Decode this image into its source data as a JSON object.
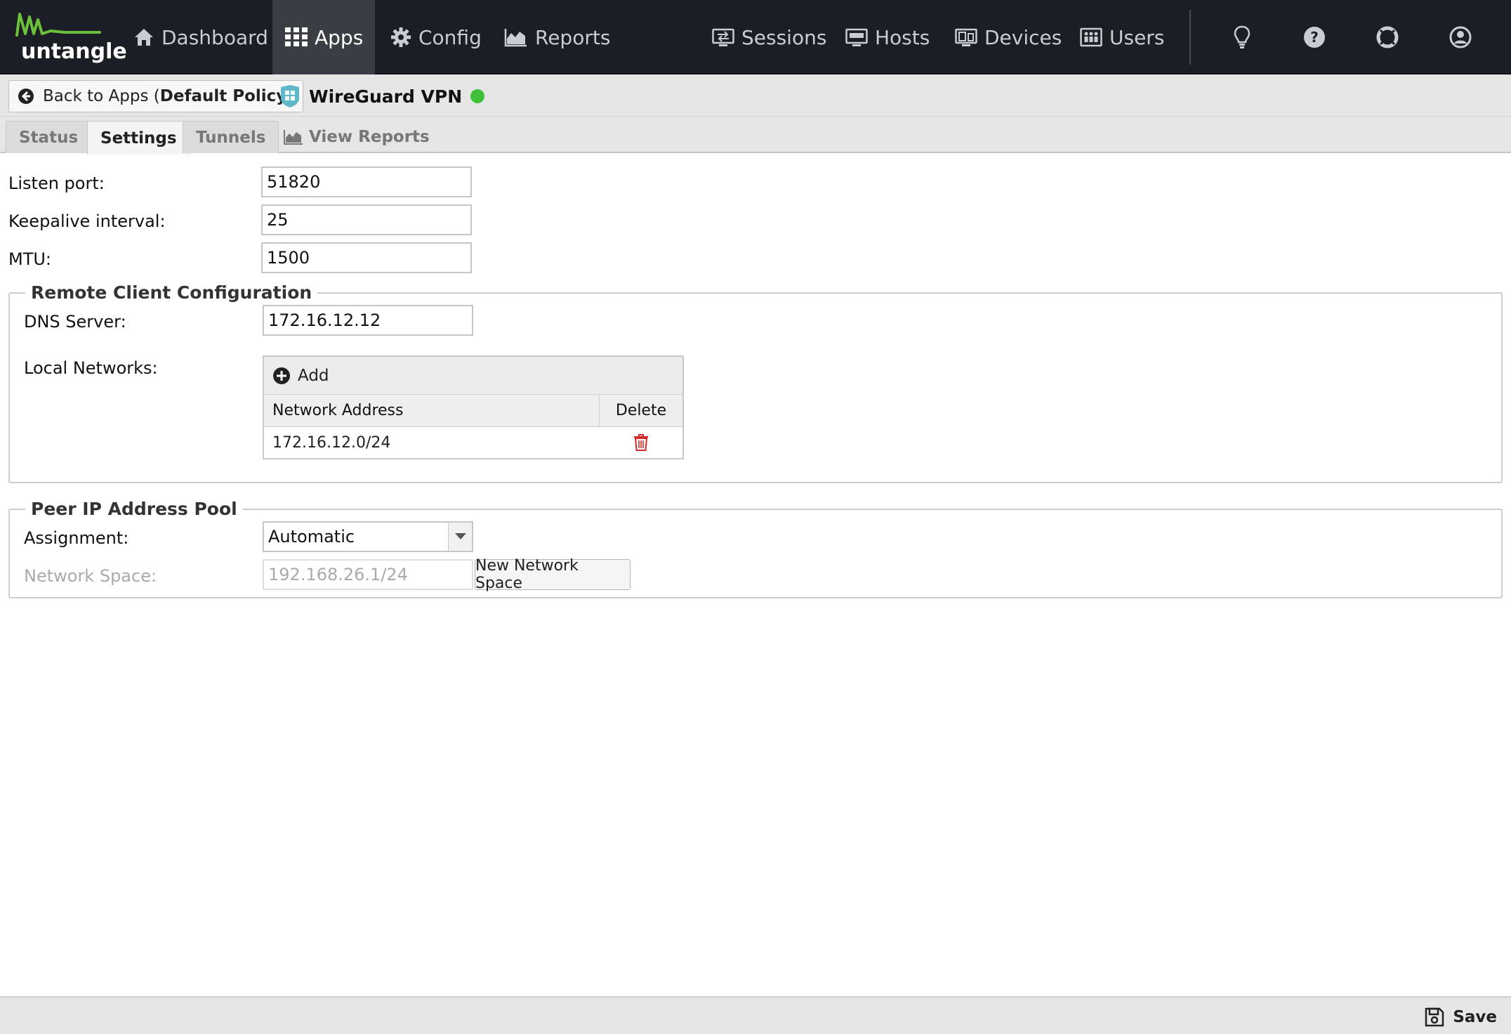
{
  "brand": {
    "logo_text": "untangle",
    "accent": "#6cbf3b"
  },
  "nav": {
    "dashboard": "Dashboard",
    "apps": "Apps",
    "config": "Config",
    "reports": "Reports",
    "sessions": "Sessions",
    "hosts": "Hosts",
    "devices": "Devices",
    "users": "Users"
  },
  "header": {
    "back_label": "Back to Apps (",
    "back_policy": "Default Policy",
    "back_close": ")",
    "app_title": "WireGuard VPN",
    "status_color": "#3fbf3a"
  },
  "tabs": [
    {
      "label": "Status"
    },
    {
      "label": "Settings"
    },
    {
      "label": "Tunnels"
    },
    {
      "label": "View Reports"
    }
  ],
  "settings": {
    "listen_port": {
      "label": "Listen port:",
      "value": "51820"
    },
    "keepalive": {
      "label": "Keepalive interval:",
      "value": "25"
    },
    "mtu": {
      "label": "MTU:",
      "value": "1500"
    }
  },
  "remote_client": {
    "legend": "Remote Client Configuration",
    "dns_label": "DNS Server:",
    "dns_value": "172.16.12.12",
    "local_networks_label": "Local Networks:",
    "add_label": "Add",
    "columns": [
      "Network Address",
      "Delete"
    ],
    "rows": [
      {
        "address": "172.16.12.0/24"
      }
    ]
  },
  "peer_pool": {
    "legend": "Peer IP Address Pool",
    "assignment_label": "Assignment:",
    "assignment_value": "Automatic",
    "network_space_label": "Network Space:",
    "network_space_value": "192.168.26.1/24",
    "new_space_button": "New Network Space"
  },
  "footer": {
    "save_label": "Save"
  }
}
